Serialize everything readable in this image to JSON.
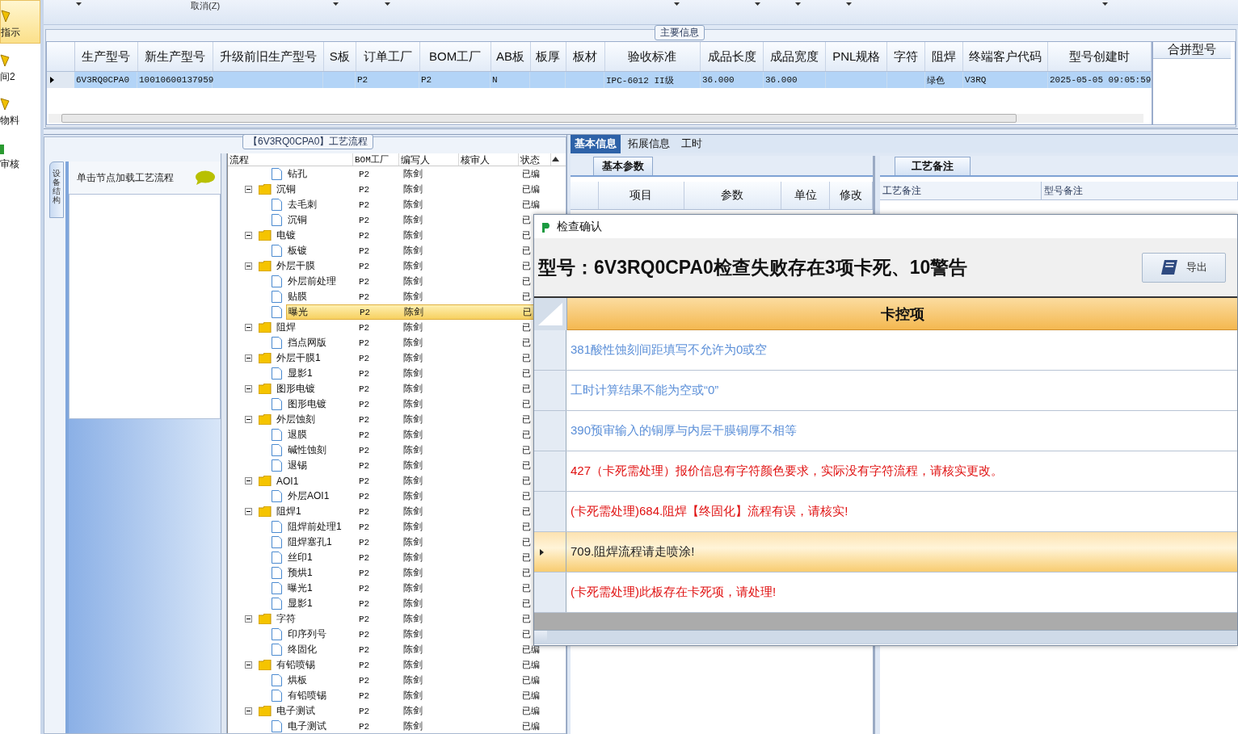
{
  "nav": [
    {
      "label": "指示",
      "selected": true
    },
    {
      "label": "间2",
      "selected": false
    },
    {
      "label": "物料",
      "selected": false
    },
    {
      "label": "审核",
      "selected": false
    }
  ],
  "toolbar": {
    "cancel": "取消(Z)"
  },
  "main_info": {
    "title": "主要信息",
    "columns": [
      "生产型号",
      "新生产型号",
      "升级前旧生产型号",
      "S板",
      "订单工厂",
      "BOM工厂",
      "AB板",
      "板厚",
      "板材",
      "验收标准",
      "成品长度",
      "成品宽度",
      "PNL规格",
      "字符",
      "阻焊",
      "终端客户代码",
      "型号创建时"
    ],
    "rows": [
      {
        "selected": true,
        "cells": [
          "6V3RQ0CPA0",
          "10010600137959",
          null,
          null,
          "P2",
          "P2",
          "N",
          null,
          null,
          "IPC-6012 II级",
          "36.000",
          "36.000",
          null,
          null,
          "绿色",
          "V3RQ",
          "2025-05-05 09:05:59"
        ]
      }
    ],
    "side_column": "合拼型号"
  },
  "process": {
    "title": "【6V3RQ0CPA0】工艺流程",
    "side_tab": "设备结构",
    "hint": "单击节点加载工艺流程",
    "columns": [
      "流程",
      "BOM工厂",
      "编写人",
      "核审人",
      "状态"
    ],
    "tree": [
      {
        "kind": "file",
        "label": "钻孔",
        "bom": "P2",
        "writer": "陈剑",
        "status": "已编",
        "selected": false
      },
      {
        "kind": "folder",
        "label": "沉铜",
        "bom": "P2",
        "writer": "陈剑",
        "status": "已编",
        "selected": false,
        "expanded": true,
        "children": [
          {
            "kind": "file",
            "label": "去毛刺",
            "bom": "P2",
            "writer": "陈剑",
            "status": "已编",
            "selected": false
          },
          {
            "kind": "file",
            "label": "沉铜",
            "bom": "P2",
            "writer": "陈剑",
            "status": "已",
            "selected": false
          }
        ]
      },
      {
        "kind": "folder",
        "label": "电镀",
        "bom": "P2",
        "writer": "陈剑",
        "status": "已",
        "selected": false,
        "expanded": true,
        "children": [
          {
            "kind": "file",
            "label": "板镀",
            "bom": "P2",
            "writer": "陈剑",
            "status": "已",
            "selected": false
          }
        ]
      },
      {
        "kind": "folder",
        "label": "外层干膜",
        "bom": "P2",
        "writer": "陈剑",
        "status": "已",
        "selected": false,
        "expanded": true,
        "children": [
          {
            "kind": "file",
            "label": "外层前处理",
            "bom": "P2",
            "writer": "陈剑",
            "status": "已",
            "selected": false
          },
          {
            "kind": "file",
            "label": "贴膜",
            "bom": "P2",
            "writer": "陈剑",
            "status": "已",
            "selected": false
          },
          {
            "kind": "file",
            "label": "曝光",
            "bom": "P2",
            "writer": "陈剑",
            "status": "已",
            "selected": true
          }
        ]
      },
      {
        "kind": "folder",
        "label": "阻焊",
        "bom": "P2",
        "writer": "陈剑",
        "status": "已",
        "selected": false,
        "expanded": true,
        "children": [
          {
            "kind": "file",
            "label": "挡点网版",
            "bom": "P2",
            "writer": "陈剑",
            "status": "已",
            "selected": false
          }
        ]
      },
      {
        "kind": "folder",
        "label": "外层干膜1",
        "bom": "P2",
        "writer": "陈剑",
        "status": "已",
        "selected": false,
        "expanded": true,
        "children": [
          {
            "kind": "file",
            "label": "显影1",
            "bom": "P2",
            "writer": "陈剑",
            "status": "已",
            "selected": false
          }
        ]
      },
      {
        "kind": "folder",
        "label": "图形电镀",
        "bom": "P2",
        "writer": "陈剑",
        "status": "已",
        "selected": false,
        "expanded": true,
        "children": [
          {
            "kind": "file",
            "label": "图形电镀",
            "bom": "P2",
            "writer": "陈剑",
            "status": "已",
            "selected": false
          }
        ]
      },
      {
        "kind": "folder",
        "label": "外层蚀刻",
        "bom": "P2",
        "writer": "陈剑",
        "status": "已",
        "selected": false,
        "expanded": true,
        "children": [
          {
            "kind": "file",
            "label": "退膜",
            "bom": "P2",
            "writer": "陈剑",
            "status": "已",
            "selected": false
          },
          {
            "kind": "file",
            "label": "碱性蚀刻",
            "bom": "P2",
            "writer": "陈剑",
            "status": "已",
            "selected": false
          },
          {
            "kind": "file",
            "label": "退锡",
            "bom": "P2",
            "writer": "陈剑",
            "status": "已",
            "selected": false
          }
        ]
      },
      {
        "kind": "folder",
        "label": "AOI1",
        "bom": "P2",
        "writer": "陈剑",
        "status": "已",
        "selected": false,
        "expanded": true,
        "children": [
          {
            "kind": "file",
            "label": "外层AOI1",
            "bom": "P2",
            "writer": "陈剑",
            "status": "已",
            "selected": false
          }
        ]
      },
      {
        "kind": "folder",
        "label": "阻焊1",
        "bom": "P2",
        "writer": "陈剑",
        "status": "已",
        "selected": false,
        "expanded": true,
        "children": [
          {
            "kind": "file",
            "label": "阻焊前处理1",
            "bom": "P2",
            "writer": "陈剑",
            "status": "已",
            "selected": false
          },
          {
            "kind": "file",
            "label": "阻焊塞孔1",
            "bom": "P2",
            "writer": "陈剑",
            "status": "已",
            "selected": false
          },
          {
            "kind": "file",
            "label": "丝印1",
            "bom": "P2",
            "writer": "陈剑",
            "status": "已",
            "selected": false
          },
          {
            "kind": "file",
            "label": "预烘1",
            "bom": "P2",
            "writer": "陈剑",
            "status": "已",
            "selected": false
          },
          {
            "kind": "file",
            "label": "曝光1",
            "bom": "P2",
            "writer": "陈剑",
            "status": "已",
            "selected": false
          },
          {
            "kind": "file",
            "label": "显影1",
            "bom": "P2",
            "writer": "陈剑",
            "status": "已",
            "selected": false
          }
        ]
      },
      {
        "kind": "folder",
        "label": "字符",
        "bom": "P2",
        "writer": "陈剑",
        "status": "已",
        "selected": false,
        "expanded": true,
        "children": [
          {
            "kind": "file",
            "label": "印序列号",
            "bom": "P2",
            "writer": "陈剑",
            "status": "已",
            "selected": false
          },
          {
            "kind": "file",
            "label": "终固化",
            "bom": "P2",
            "writer": "陈剑",
            "status": "已编",
            "selected": false
          }
        ]
      },
      {
        "kind": "folder",
        "label": "有铅喷锡",
        "bom": "P2",
        "writer": "陈剑",
        "status": "已编",
        "selected": false,
        "expanded": true,
        "children": [
          {
            "kind": "file",
            "label": "烘板",
            "bom": "P2",
            "writer": "陈剑",
            "status": "已编",
            "selected": false
          },
          {
            "kind": "file",
            "label": "有铅喷锡",
            "bom": "P2",
            "writer": "陈剑",
            "status": "已编",
            "selected": false
          }
        ]
      },
      {
        "kind": "folder",
        "label": "电子测试",
        "bom": "P2",
        "writer": "陈剑",
        "status": "已编",
        "selected": false,
        "expanded": true,
        "children": [
          {
            "kind": "file",
            "label": "电子测试",
            "bom": "P2",
            "writer": "陈剑",
            "status": "已编",
            "selected": false
          }
        ]
      }
    ]
  },
  "detail": {
    "tabs": [
      {
        "label": "基本信息",
        "selected": true
      },
      {
        "label": "拓展信息",
        "selected": false
      },
      {
        "label": "工时",
        "selected": false
      }
    ],
    "params": {
      "tab": "基本参数",
      "columns": [
        "项目",
        "参数",
        "单位",
        "修改"
      ]
    },
    "notes": {
      "tab": "工艺备注",
      "columns": [
        "工艺备注",
        "型号备注"
      ]
    }
  },
  "dialog": {
    "title": "检查确认",
    "heading": "型号：6V3RQ0CPA0检查失败存在3项卡死、10警告",
    "export_button": "导出",
    "column": "卡控项",
    "rows": [
      {
        "text": "381酸性蚀刻间距填写不允许为0或空",
        "color": "#5b8fd8",
        "selected": false
      },
      {
        "text": "工时计算结果不能为空或“0”",
        "color": "#5b8fd8",
        "selected": false
      },
      {
        "text": "390预审输入的铜厚与内层干膜铜厚不相等",
        "color": "#5b8fd8",
        "selected": false
      },
      {
        "text": "427（卡死需处理）报价信息有字符颜色要求，实际没有字符流程，请核实更改。",
        "color": "#e01010",
        "selected": false
      },
      {
        "text": "(卡死需处理)684.阻焊【终固化】流程有误，请核实!",
        "color": "#e01010",
        "selected": false
      },
      {
        "text": "709.阻焊流程请走喷涂!",
        "color": "#222222",
        "selected": true
      },
      {
        "text": "(卡死需处理)此板存在卡死项，请处理!",
        "color": "#e01010",
        "selected": false
      }
    ]
  }
}
